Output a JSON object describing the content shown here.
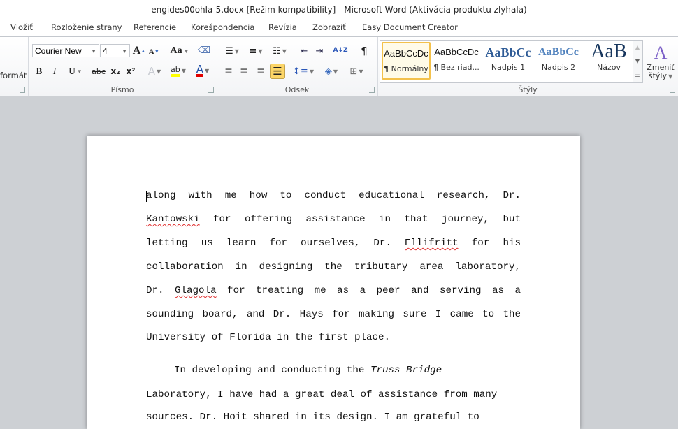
{
  "window": {
    "title": "engides00ohla-5.docx [Režim kompatibility]  -  Microsoft Word (Aktivácia produktu zlyhala)"
  },
  "tabs": [
    "Vložiť",
    "Rozloženie strany",
    "Referencie",
    "Korešpondencia",
    "Revízia",
    "Zobraziť",
    "Easy Document Creator"
  ],
  "ribbon": {
    "clipboard": {
      "partial_label": "formát"
    },
    "font": {
      "label": "Písmo",
      "font_name": "Courier New",
      "font_size": "4",
      "grow_icon": "A",
      "shrink_icon": "A",
      "change_case_icon": "Aa",
      "bold": "B",
      "italic": "I",
      "underline": "U",
      "strikethrough": "abc",
      "subscript": "x₂",
      "superscript": "x²",
      "text_effects_icon": "A",
      "highlight_icon": "ab",
      "font_color_icon": "A",
      "highlight_color": "#ffff00",
      "font_color": "#e00000"
    },
    "paragraph": {
      "label": "Odsek",
      "sort_icon": "A↓Z",
      "show_marks_icon": "¶",
      "active_alignment": "justify",
      "active_color": "#fcd567"
    },
    "styles": {
      "label": "Štýly",
      "items": [
        {
          "preview": "AaBbCcDc",
          "name": "¶ Normálny",
          "selected": true
        },
        {
          "preview": "AaBbCcDc",
          "name": "¶ Bez riad...",
          "selected": false
        },
        {
          "preview": "AaBbCc",
          "name": "Nadpis 1",
          "selected": false
        },
        {
          "preview": "AaBbCc",
          "name": "Nadpis 2",
          "selected": false
        },
        {
          "preview": "AaB",
          "name": "Názov",
          "selected": false
        }
      ],
      "change_styles_line1": "Zmeniť",
      "change_styles_line2": "štýly"
    }
  },
  "document": {
    "lines": [
      "along with me how to conduct educational research, Dr.",
      "Kantowski for offering assistance in that journey, but",
      "letting us learn for ourselves, Dr. Ellifritt for his",
      "collaboration in designing the tributary area laboratory,",
      "Dr. Glagola for treating me as a peer and serving as a",
      "sounding board, and Dr. Hays for making sure I came to the",
      "University of Florida in the first place."
    ],
    "para2_line1_prefix": "In developing and conducting the ",
    "para2_line1_italic": "Truss Bridge",
    "para2_lines": [
      "Laboratory, I have had a great deal of assistance from many",
      "sources. Dr. Hoit shared in its design. I am grateful to"
    ],
    "misspelled": [
      "Kantowski",
      "Ellifritt",
      "Glagola"
    ]
  }
}
